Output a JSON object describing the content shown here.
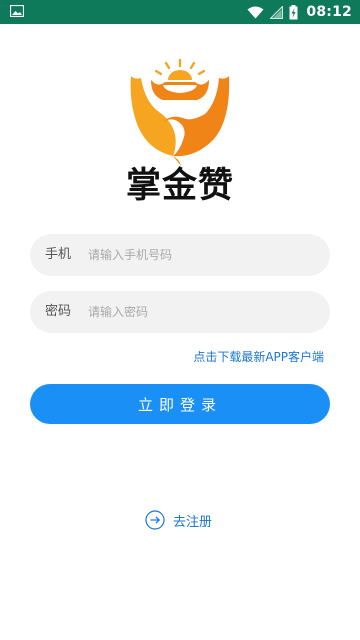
{
  "status_bar": {
    "time": "08:12",
    "background_color": "#0f7a5a",
    "icons": [
      "image-icon",
      "wifi-icon",
      "signal-icon",
      "battery-icon"
    ]
  },
  "brand": {
    "name": "掌金赞",
    "logo_colors": [
      "#f6a521",
      "#f08416"
    ]
  },
  "form": {
    "phone_label": "手机",
    "phone_placeholder": "请输入手机号码",
    "password_label": "密码",
    "password_placeholder": "请输入密码"
  },
  "download_link": "点击下载最新APP客户端",
  "login_button": "立即登录",
  "register_link": "去注册",
  "colors": {
    "accent": "#1a8ff5",
    "link": "#1976d2",
    "field_bg": "#f2f2f2"
  }
}
